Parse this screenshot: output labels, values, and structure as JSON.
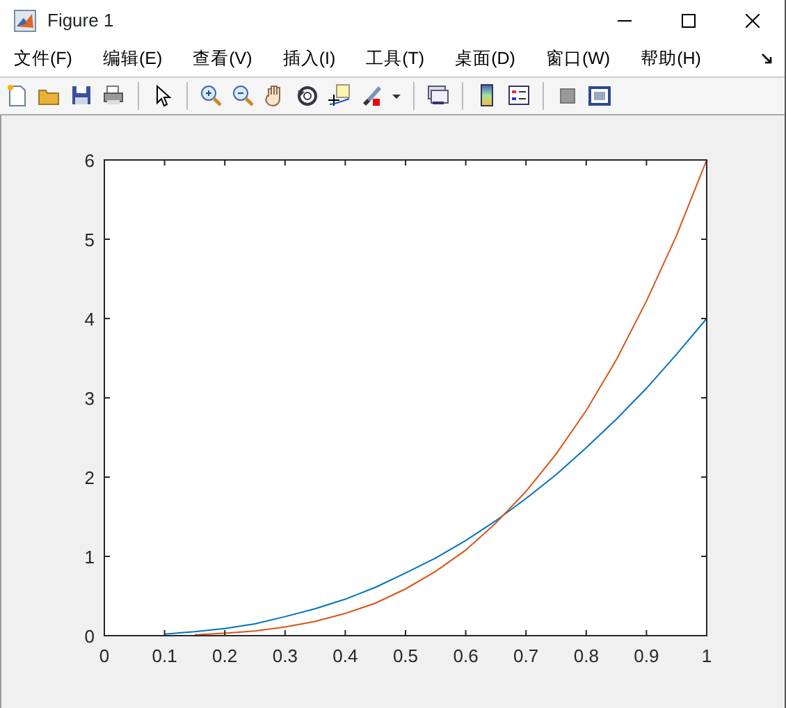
{
  "window": {
    "title": "Figure 1"
  },
  "menu": [
    {
      "label": "文件(F)"
    },
    {
      "label": "编辑(E)"
    },
    {
      "label": "查看(V)"
    },
    {
      "label": "插入(I)"
    },
    {
      "label": "工具(T)"
    },
    {
      "label": "桌面(D)"
    },
    {
      "label": "窗口(W)"
    },
    {
      "label": "帮助(H)"
    }
  ],
  "chart_data": {
    "type": "line",
    "x": [
      0.1,
      0.15,
      0.2,
      0.25,
      0.3,
      0.35,
      0.4,
      0.45,
      0.5,
      0.55,
      0.6,
      0.65,
      0.7,
      0.75,
      0.8,
      0.85,
      0.9,
      0.95,
      1
    ],
    "series": [
      {
        "color": "#0072bd",
        "values": [
          0.02,
          0.05,
          0.09,
          0.15,
          0.24,
          0.34,
          0.46,
          0.61,
          0.79,
          0.98,
          1.2,
          1.45,
          1.73,
          2.03,
          2.37,
          2.73,
          3.12,
          3.55,
          4
        ]
      },
      {
        "color": "#d95319",
        "values": [
          null,
          0.01,
          0.03,
          0.06,
          0.11,
          0.18,
          0.28,
          0.41,
          0.59,
          0.81,
          1.08,
          1.42,
          1.82,
          2.29,
          2.84,
          3.48,
          4.22,
          5.05,
          6
        ]
      }
    ],
    "xlim": [
      0,
      1
    ],
    "ylim": [
      0,
      6
    ],
    "xticks": [
      0,
      0.1,
      0.2,
      0.3,
      0.4,
      0.5,
      0.6,
      0.7,
      0.8,
      0.9,
      1
    ],
    "yticks": [
      0,
      1,
      2,
      3,
      4,
      5,
      6
    ]
  }
}
